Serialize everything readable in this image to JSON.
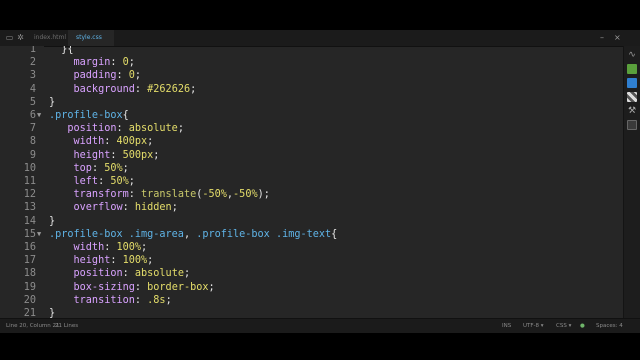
{
  "tabs": [
    {
      "label": "index.html",
      "active": false
    },
    {
      "label": "style.css",
      "active": true
    }
  ],
  "window_controls": {
    "minimize": "–",
    "close": "×"
  },
  "code": {
    "lines": [
      {
        "num": "1",
        "tokens": [
          {
            "t": "  }{",
            "c": "pun"
          }
        ],
        "partial": true
      },
      {
        "num": "2",
        "tokens": [
          {
            "t": "    margin",
            "c": "prop"
          },
          {
            "t": ": ",
            "c": "pun"
          },
          {
            "t": "0",
            "c": "num"
          },
          {
            "t": ";",
            "c": "pun"
          }
        ]
      },
      {
        "num": "3",
        "tokens": [
          {
            "t": "    padding",
            "c": "prop"
          },
          {
            "t": ": ",
            "c": "pun"
          },
          {
            "t": "0",
            "c": "num"
          },
          {
            "t": ";",
            "c": "pun"
          }
        ]
      },
      {
        "num": "4",
        "tokens": [
          {
            "t": "    background",
            "c": "prop"
          },
          {
            "t": ": ",
            "c": "pun"
          },
          {
            "t": "#262626",
            "c": "val"
          },
          {
            "t": ";",
            "c": "pun"
          }
        ]
      },
      {
        "num": "5",
        "tokens": [
          {
            "t": "}",
            "c": "pun"
          }
        ]
      },
      {
        "num": "6",
        "fold": true,
        "tokens": [
          {
            "t": ".profile-box",
            "c": "sel"
          },
          {
            "t": "{",
            "c": "pun"
          }
        ]
      },
      {
        "num": "7",
        "tokens": [
          {
            "t": "   position",
            "c": "prop"
          },
          {
            "t": ": ",
            "c": "pun"
          },
          {
            "t": "absolute",
            "c": "val"
          },
          {
            "t": ";",
            "c": "pun"
          }
        ]
      },
      {
        "num": "8",
        "tokens": [
          {
            "t": "    width",
            "c": "prop"
          },
          {
            "t": ": ",
            "c": "pun"
          },
          {
            "t": "400px",
            "c": "num"
          },
          {
            "t": ";",
            "c": "pun"
          }
        ]
      },
      {
        "num": "9",
        "tokens": [
          {
            "t": "    height",
            "c": "prop"
          },
          {
            "t": ": ",
            "c": "pun"
          },
          {
            "t": "500px",
            "c": "num"
          },
          {
            "t": ";",
            "c": "pun"
          }
        ]
      },
      {
        "num": "10",
        "tokens": [
          {
            "t": "    top",
            "c": "prop"
          },
          {
            "t": ": ",
            "c": "pun"
          },
          {
            "t": "50%",
            "c": "num"
          },
          {
            "t": ";",
            "c": "pun"
          }
        ]
      },
      {
        "num": "11",
        "tokens": [
          {
            "t": "    left",
            "c": "prop"
          },
          {
            "t": ": ",
            "c": "pun"
          },
          {
            "t": "50%",
            "c": "num"
          },
          {
            "t": ";",
            "c": "pun"
          }
        ]
      },
      {
        "num": "12",
        "tokens": [
          {
            "t": "    transform",
            "c": "prop"
          },
          {
            "t": ": ",
            "c": "pun"
          },
          {
            "t": "translate",
            "c": "fn"
          },
          {
            "t": "(",
            "c": "pun"
          },
          {
            "t": "-50%",
            "c": "num"
          },
          {
            "t": ",",
            "c": "pun"
          },
          {
            "t": "-50%",
            "c": "num"
          },
          {
            "t": ");",
            "c": "pun"
          }
        ]
      },
      {
        "num": "13",
        "tokens": [
          {
            "t": "    overflow",
            "c": "prop"
          },
          {
            "t": ": ",
            "c": "pun"
          },
          {
            "t": "hidden",
            "c": "val"
          },
          {
            "t": ";",
            "c": "pun"
          }
        ]
      },
      {
        "num": "14",
        "tokens": [
          {
            "t": "}",
            "c": "pun"
          }
        ]
      },
      {
        "num": "15",
        "fold": true,
        "tokens": [
          {
            "t": ".profile-box .img-area",
            "c": "sel"
          },
          {
            "t": ", ",
            "c": "pun"
          },
          {
            "t": ".profile-box .img-text",
            "c": "sel"
          },
          {
            "t": "{",
            "c": "pun"
          }
        ]
      },
      {
        "num": "16",
        "tokens": [
          {
            "t": "    width",
            "c": "prop"
          },
          {
            "t": ": ",
            "c": "pun"
          },
          {
            "t": "100%",
            "c": "num"
          },
          {
            "t": ";",
            "c": "pun"
          }
        ]
      },
      {
        "num": "17",
        "tokens": [
          {
            "t": "    height",
            "c": "prop"
          },
          {
            "t": ": ",
            "c": "pun"
          },
          {
            "t": "100%",
            "c": "num"
          },
          {
            "t": ";",
            "c": "pun"
          }
        ]
      },
      {
        "num": "18",
        "tokens": [
          {
            "t": "    position",
            "c": "prop"
          },
          {
            "t": ": ",
            "c": "pun"
          },
          {
            "t": "absolute",
            "c": "val"
          },
          {
            "t": ";",
            "c": "pun"
          }
        ]
      },
      {
        "num": "19",
        "tokens": [
          {
            "t": "    box-sizing",
            "c": "prop"
          },
          {
            "t": ": ",
            "c": "pun"
          },
          {
            "t": "border-box",
            "c": "val"
          },
          {
            "t": ";",
            "c": "pun"
          }
        ]
      },
      {
        "num": "20",
        "tokens": [
          {
            "t": "    transition",
            "c": "prop"
          },
          {
            "t": ": ",
            "c": "pun"
          },
          {
            "t": ".8s",
            "c": "num"
          },
          {
            "t": ";",
            "c": "pun"
          }
        ]
      },
      {
        "num": "21",
        "tokens": [
          {
            "t": "}",
            "c": "pun"
          }
        ]
      }
    ]
  },
  "status": {
    "cursor": "Line 20, Column 21",
    "lines_count": "21 Lines",
    "mode": "INS",
    "encoding": "UTF-8",
    "language": "CSS",
    "spaces": "Spaces:  4"
  },
  "sidebar_icons": [
    "live-preview-icon",
    "extension-manager-icon",
    "git-icon",
    "linter-icon",
    "wrench-icon",
    "beautify-icon"
  ],
  "colors": {
    "background": "#262626",
    "selector": "#5fb3e6",
    "property": "#d9a2ff",
    "value": "#e4dd6a"
  }
}
